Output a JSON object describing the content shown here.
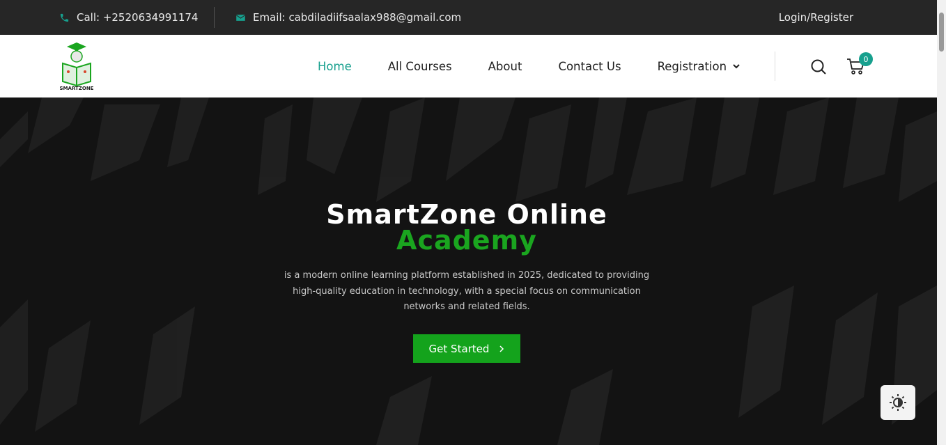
{
  "topbar": {
    "call": "Call: +2520634991174",
    "email": "Email: cabdiladiifsaalax988@gmail.com",
    "login": "Login/Register"
  },
  "header": {
    "logo_text": "SMARTZONE",
    "nav": [
      {
        "label": "Home",
        "active": true
      },
      {
        "label": "All Courses"
      },
      {
        "label": "About"
      },
      {
        "label": "Contact Us"
      },
      {
        "label": "Registration"
      }
    ],
    "cart_count": "0"
  },
  "hero": {
    "title_line1": "SmartZone Online",
    "title_line2": "Academy",
    "description": "is a modern online learning platform established in 2025, dedicated to providing high-quality education in technology, with a special focus on communication networks and related fields.",
    "cta_label": "Get Started"
  },
  "colors": {
    "accent_teal": "#17a08e",
    "accent_green": "#14a31c",
    "topbar_bg": "#262626"
  },
  "icons": [
    "phone-icon",
    "envelope-icon",
    "search-icon",
    "cart-icon",
    "chevron-down-icon",
    "chevron-right-icon",
    "theme-toggle-icon"
  ]
}
